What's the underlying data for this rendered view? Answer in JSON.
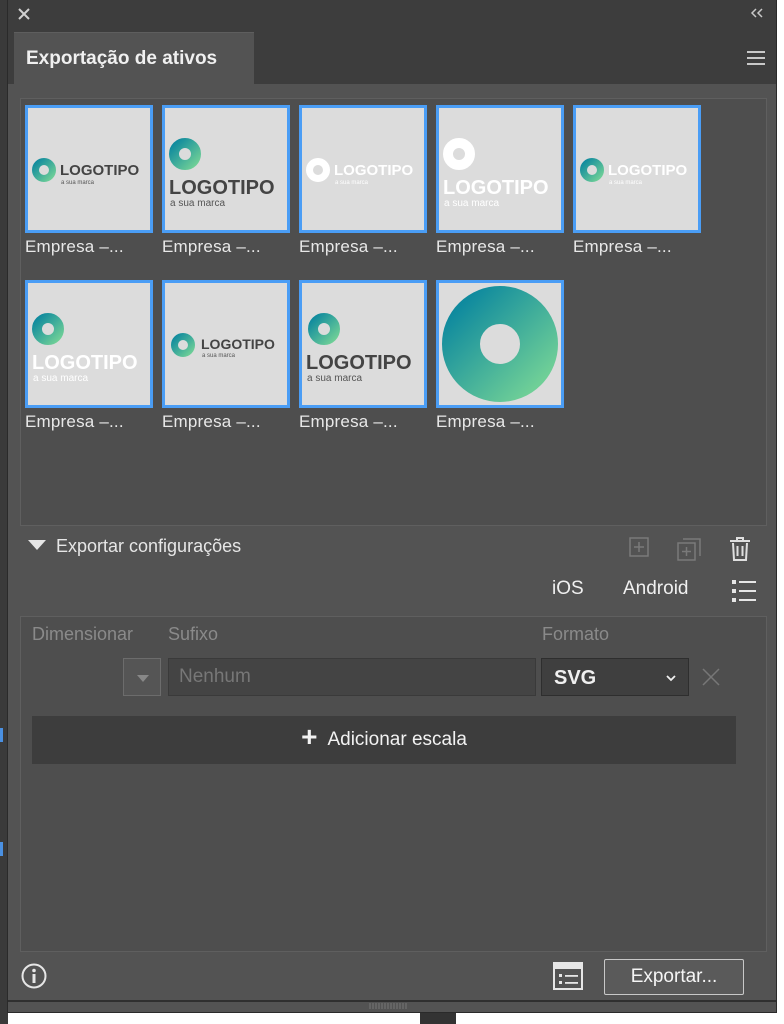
{
  "panel": {
    "tab_title": "Exportação de ativos"
  },
  "assets": [
    {
      "label": "Empresa –...",
      "variant": "h-dark"
    },
    {
      "label": "Empresa –...",
      "variant": "v-dark"
    },
    {
      "label": "Empresa –...",
      "variant": "h-white"
    },
    {
      "label": "Empresa –...",
      "variant": "v-white"
    },
    {
      "label": "Empresa –...",
      "variant": "h-mixed"
    },
    {
      "label": "Empresa –...",
      "variant": "v-mixed"
    },
    {
      "label": "Empresa –...",
      "variant": "h-dark-small"
    },
    {
      "label": "Empresa –...",
      "variant": "v-dark2"
    },
    {
      "label": "Empresa –...",
      "variant": "ring"
    }
  ],
  "logo_text": {
    "main": "LOGOTIPO",
    "sub": "a sua marca"
  },
  "export_settings": {
    "section_label": "Exportar configurações",
    "ios_label": "iOS",
    "android_label": "Android",
    "col_dimension": "Dimensionar",
    "col_suffix": "Sufixo",
    "col_format": "Formato",
    "suffix_placeholder": "Nenhum",
    "format_value": "SVG",
    "add_scale_label": "Adicionar escala"
  },
  "footer": {
    "export_label": "Exportar..."
  },
  "colors": {
    "panel_bg": "#535353",
    "selection_blue": "#4a9df5",
    "gradient_start": "#0f8a9e",
    "gradient_end": "#6fcf97"
  }
}
